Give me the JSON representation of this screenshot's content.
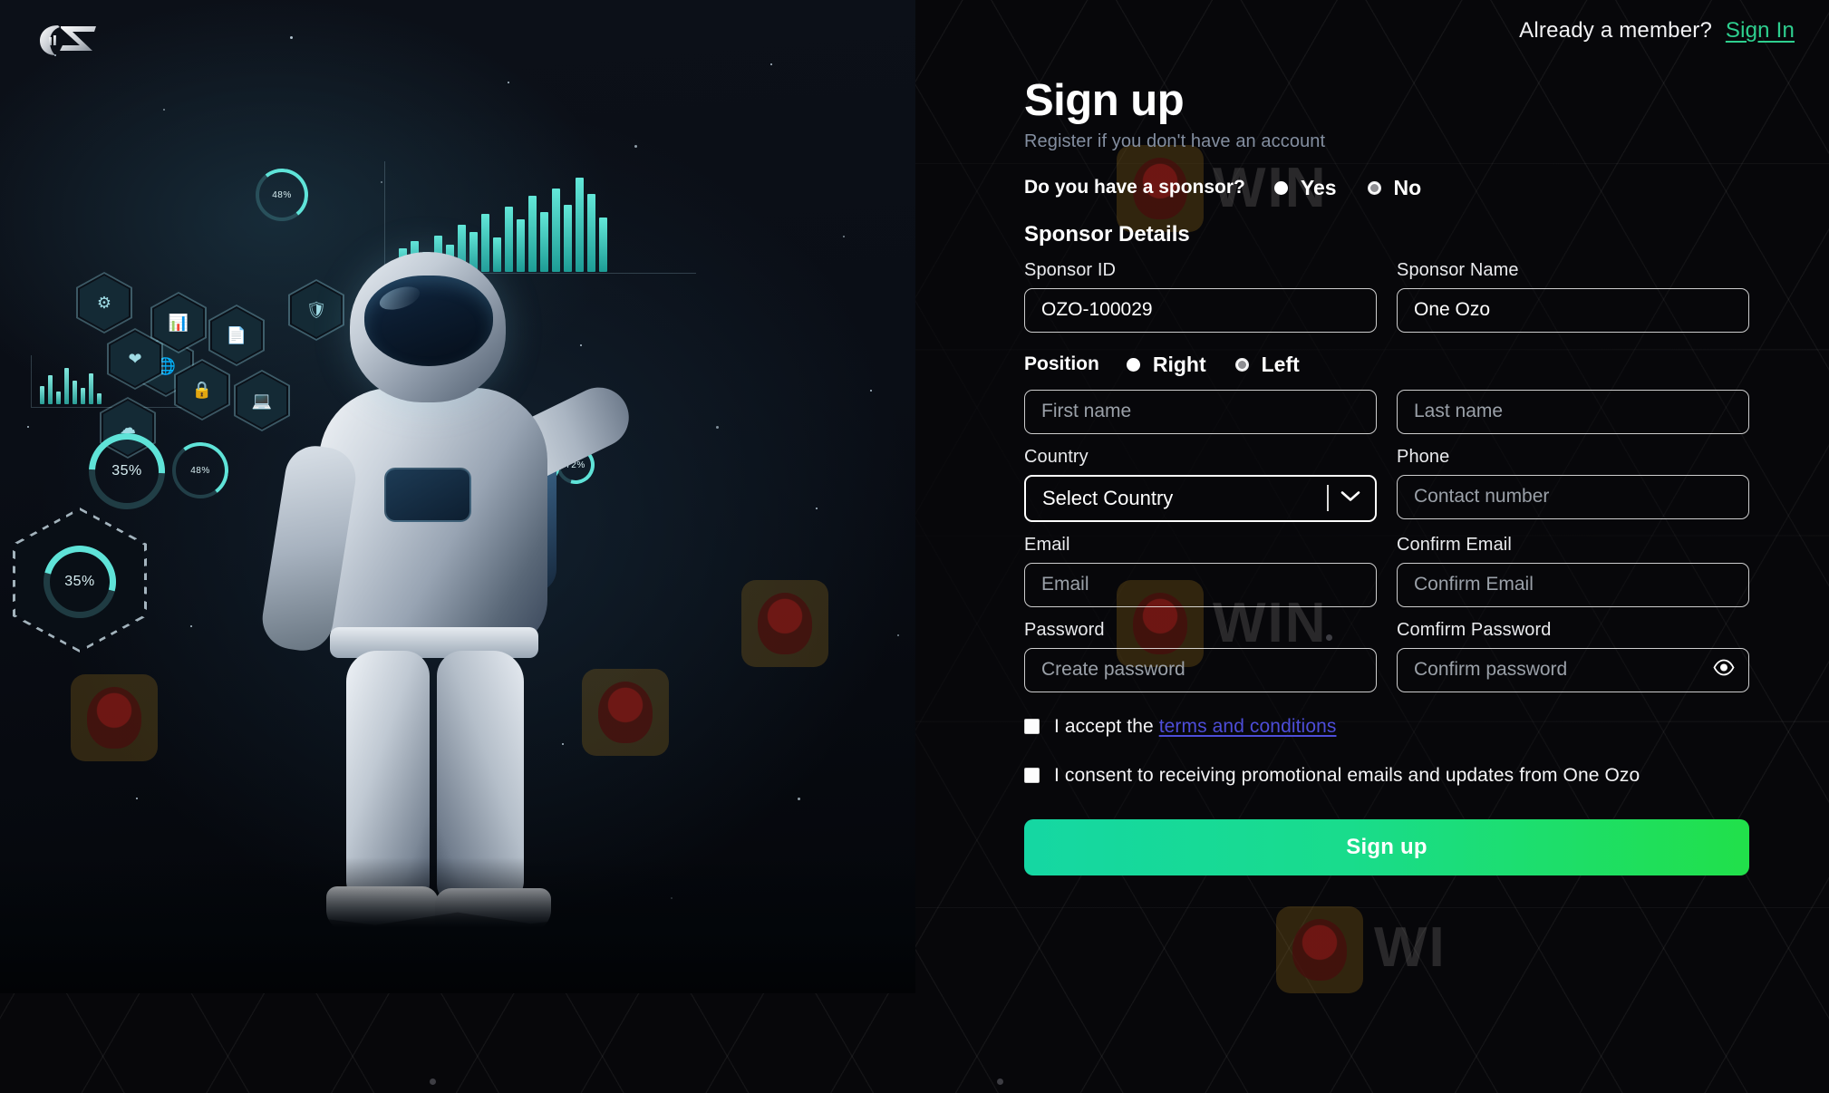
{
  "brand": {
    "logo_text": "OZ",
    "name": "One Ozo"
  },
  "top": {
    "member_prompt": "Already a member?",
    "sign_in_label": "Sign In"
  },
  "header": {
    "title": "Sign up",
    "subtitle": "Register if you don't have an account"
  },
  "sponsor_question": {
    "label": "Do you have a sponsor?",
    "options": [
      {
        "value": "yes",
        "label": "Yes",
        "selected": true
      },
      {
        "value": "no",
        "label": "No",
        "selected": false
      }
    ]
  },
  "sponsor_section": {
    "heading": "Sponsor Details",
    "sponsor_id": {
      "label": "Sponsor ID",
      "value": "OZO-100029"
    },
    "sponsor_name": {
      "label": "Sponsor Name",
      "value": "One Ozo"
    }
  },
  "position": {
    "label": "Position",
    "options": [
      {
        "value": "right",
        "label": "Right",
        "selected": true
      },
      {
        "value": "left",
        "label": "Left",
        "selected": false
      }
    ]
  },
  "fields": {
    "first_name": {
      "placeholder": "First name",
      "value": ""
    },
    "last_name": {
      "placeholder": "Last name",
      "value": ""
    },
    "country": {
      "label": "Country",
      "selected": "Select Country",
      "options": [
        "Select Country"
      ]
    },
    "phone": {
      "label": "Phone",
      "placeholder": "Contact number",
      "value": ""
    },
    "email": {
      "label": "Email",
      "placeholder": "Email",
      "value": ""
    },
    "confirm_email": {
      "label": "Confirm Email",
      "placeholder": "Confirm Email",
      "value": ""
    },
    "password": {
      "label": "Password",
      "placeholder": "Create password",
      "value": ""
    },
    "confirm_password": {
      "label": "Comfirm Password",
      "placeholder": "Confirm password",
      "value": ""
    }
  },
  "consents": {
    "terms": {
      "prefix": "I accept the ",
      "link_text": "terms and conditions",
      "checked": false
    },
    "promo": {
      "label": "I consent to receiving promotional emails and updates from One Ozo",
      "checked": false
    }
  },
  "submit": {
    "label": "Sign up"
  },
  "artwork": {
    "gauges": [
      {
        "id": "g1",
        "value": "35%"
      },
      {
        "id": "g2",
        "value": "48%"
      },
      {
        "id": "g3",
        "value": "35%"
      },
      {
        "id": "g4",
        "value": "48%"
      },
      {
        "id": "g5",
        "value": "72%"
      },
      {
        "id": "g6",
        "value": "48%"
      },
      {
        "id": "g7",
        "value": "35%"
      }
    ]
  },
  "colors": {
    "accent_green": "#21e04a",
    "accent_teal": "#15d7a3",
    "link_green": "#2ecf8f",
    "link_blue": "#4d4dd8",
    "panel_bg": "#07070a",
    "text_muted": "#838ea0"
  }
}
